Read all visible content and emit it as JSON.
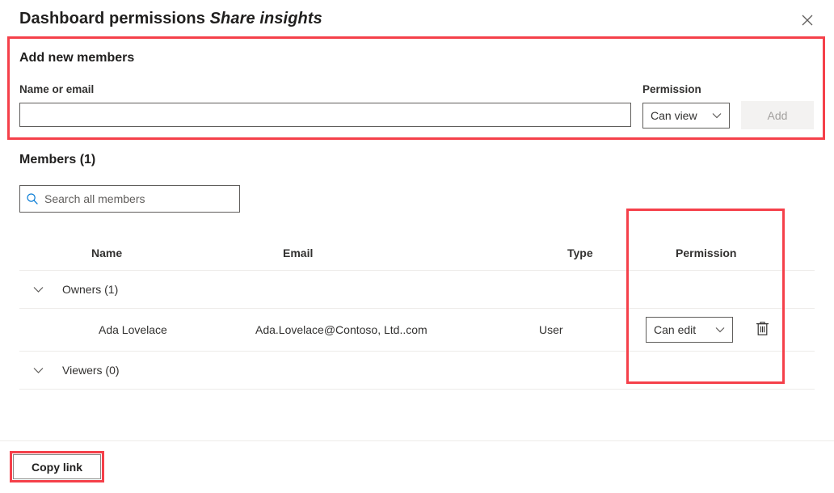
{
  "header": {
    "title_main": "Dashboard permissions ",
    "title_sub": "Share insights",
    "close_icon": "close-icon"
  },
  "add_members": {
    "heading": "Add new members",
    "name_email_label": "Name or email",
    "name_email_value": "",
    "name_email_placeholder": "",
    "permission_label": "Permission",
    "permission_value": "Can view",
    "permission_options": [
      "Can view",
      "Can edit"
    ],
    "add_button_label": "Add",
    "add_button_disabled": true
  },
  "members": {
    "heading": "Members (1)",
    "search_placeholder": "Search all members",
    "search_value": "",
    "search_icon": "search-icon",
    "columns": {
      "name": "Name",
      "email": "Email",
      "type": "Type",
      "permission": "Permission"
    },
    "groups": [
      {
        "label": "Owners (1)",
        "expanded": true,
        "rows": [
          {
            "name": "Ada Lovelace",
            "email": "Ada.Lovelace@Contoso, Ltd..com",
            "type": "User",
            "permission": "Can edit",
            "permission_options": [
              "Can view",
              "Can edit"
            ],
            "delete_icon": "trash-icon"
          }
        ]
      },
      {
        "label": "Viewers (0)",
        "expanded": true,
        "rows": []
      }
    ]
  },
  "footer": {
    "copy_link_label": "Copy link"
  },
  "annotations": {
    "highlight_color": "#f5404a",
    "boxes": [
      "add-new-members",
      "permission-column",
      "copy-link"
    ]
  }
}
